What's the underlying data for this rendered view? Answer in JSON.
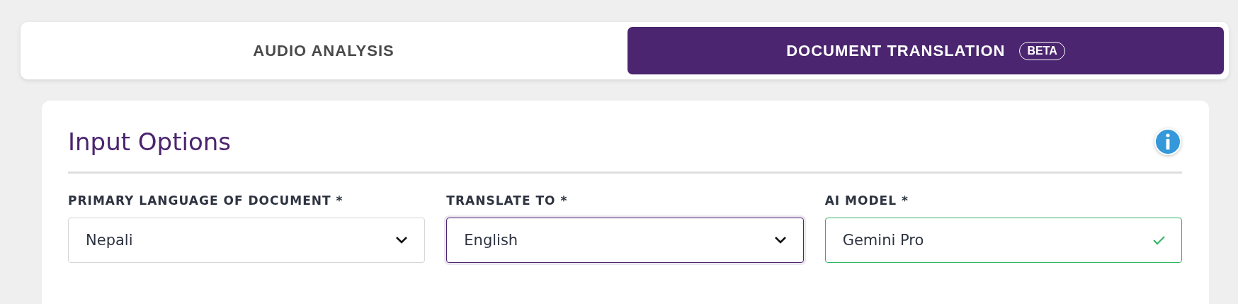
{
  "tabs": [
    {
      "label": "AUDIO ANALYSIS",
      "selected": false
    },
    {
      "label": "DOCUMENT TRANSLATION",
      "badge": "BETA",
      "selected": true
    }
  ],
  "card": {
    "title": "Input Options",
    "fields": [
      {
        "label": "PRIMARY LANGUAGE OF DOCUMENT *",
        "value": "Nepali",
        "kind": "select",
        "focused": false,
        "valid": false
      },
      {
        "label": "TRANSLATE TO *",
        "value": "English",
        "kind": "select",
        "focused": true,
        "valid": false
      },
      {
        "label": "AI MODEL *",
        "value": "Gemini Pro",
        "kind": "text",
        "focused": false,
        "valid": true
      }
    ]
  }
}
